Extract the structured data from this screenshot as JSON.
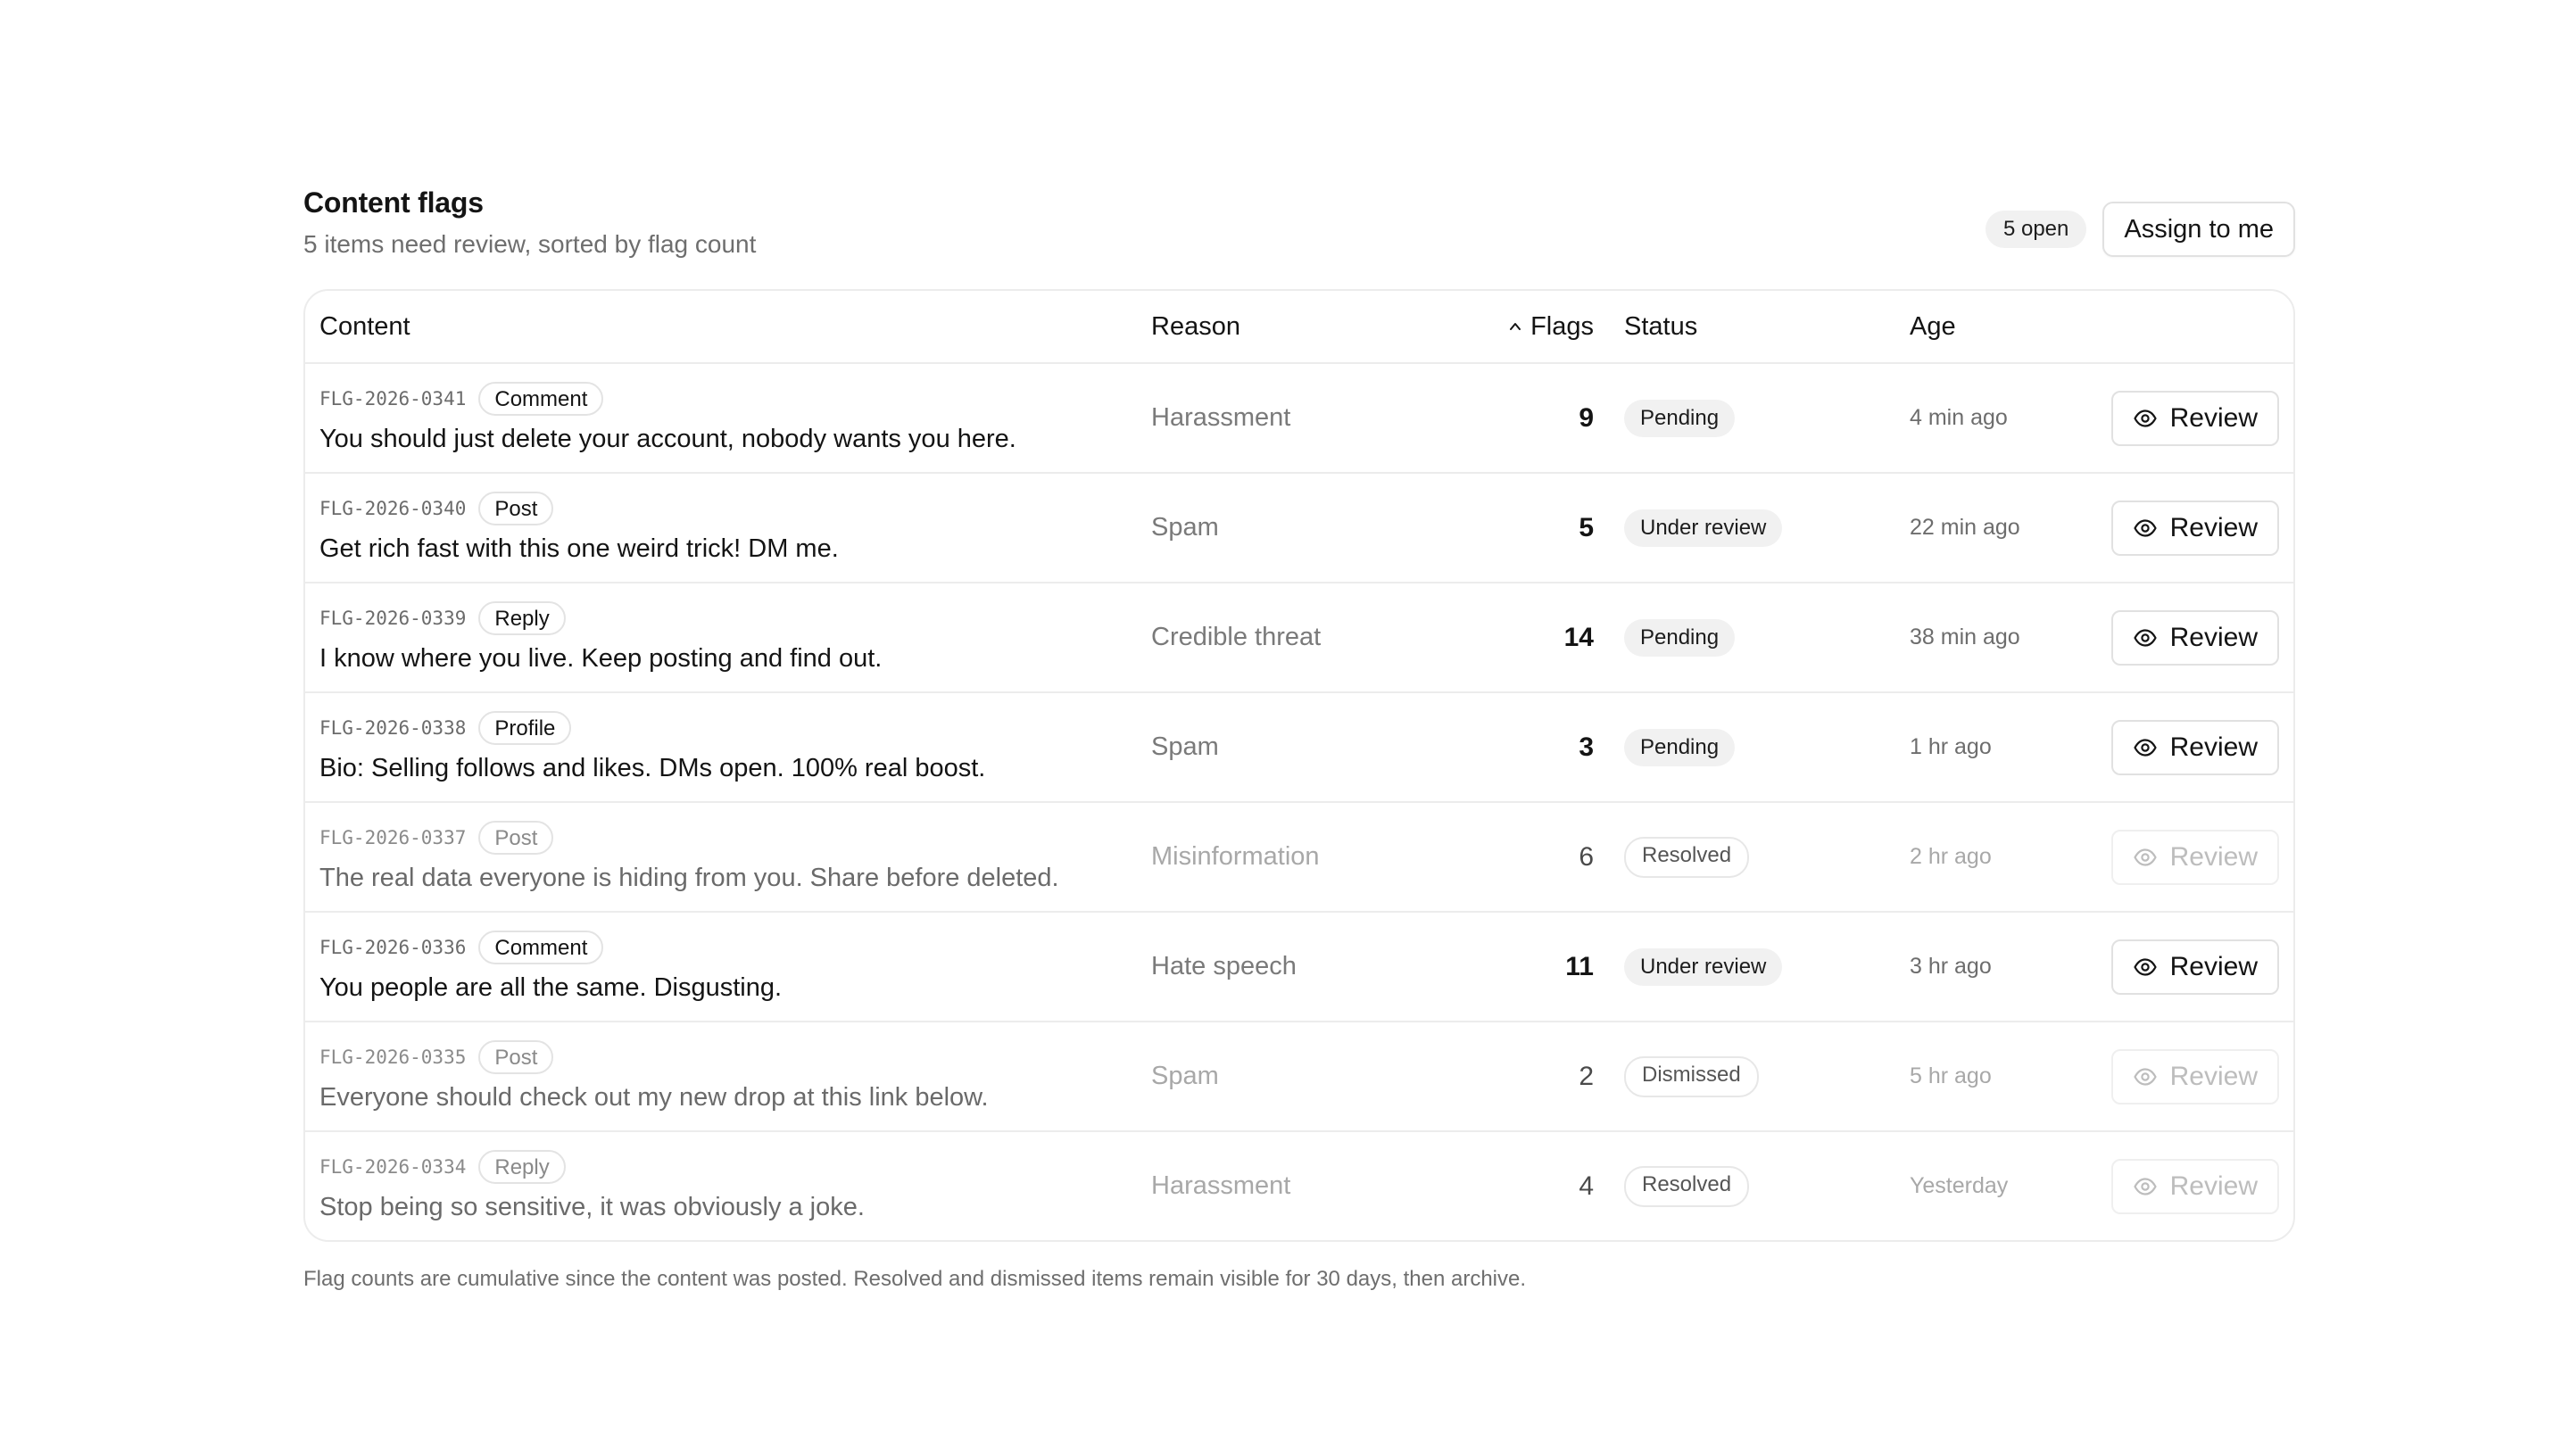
{
  "header": {
    "title": "Content flags",
    "subtitle": "5 items need review, sorted by flag count",
    "open_badge": "5 open",
    "assign_label": "Assign to me"
  },
  "table": {
    "columns": {
      "content": "Content",
      "reason": "Reason",
      "flags": "Flags",
      "status": "Status",
      "age": "Age"
    },
    "sort": {
      "column": "Flags",
      "direction": "ascending",
      "icon": "chevron-up-icon"
    },
    "review_label": "Review",
    "review_icon": "eye-icon",
    "rows": [
      {
        "id": "FLG-2026-0341",
        "type": "Comment",
        "text": "You should just delete your account, nobody wants you here.",
        "reason": "Harassment",
        "flags": "9",
        "status": "Pending",
        "status_kind": "pending",
        "age": "4 min ago",
        "muted": false
      },
      {
        "id": "FLG-2026-0340",
        "type": "Post",
        "text": "Get rich fast with this one weird trick! DM me.",
        "reason": "Spam",
        "flags": "5",
        "status": "Under review",
        "status_kind": "review",
        "age": "22 min ago",
        "muted": false
      },
      {
        "id": "FLG-2026-0339",
        "type": "Reply",
        "text": "I know where you live. Keep posting and find out.",
        "reason": "Credible threat",
        "flags": "14",
        "status": "Pending",
        "status_kind": "pending",
        "age": "38 min ago",
        "muted": false
      },
      {
        "id": "FLG-2026-0338",
        "type": "Profile",
        "text": "Bio: Selling follows and likes. DMs open. 100% real boost.",
        "reason": "Spam",
        "flags": "3",
        "status": "Pending",
        "status_kind": "pending",
        "age": "1 hr ago",
        "muted": false
      },
      {
        "id": "FLG-2026-0337",
        "type": "Post",
        "text": "The real data everyone is hiding from you. Share before deleted.",
        "reason": "Misinformation",
        "flags": "6",
        "status": "Resolved",
        "status_kind": "resolved",
        "age": "2 hr ago",
        "muted": true
      },
      {
        "id": "FLG-2026-0336",
        "type": "Comment",
        "text": "You people are all the same. Disgusting.",
        "reason": "Hate speech",
        "flags": "11",
        "status": "Under review",
        "status_kind": "review",
        "age": "3 hr ago",
        "muted": false
      },
      {
        "id": "FLG-2026-0335",
        "type": "Post",
        "text": "Everyone should check out my new drop at this link below.",
        "reason": "Spam",
        "flags": "2",
        "status": "Dismissed",
        "status_kind": "dismissed",
        "age": "5 hr ago",
        "muted": true
      },
      {
        "id": "FLG-2026-0334",
        "type": "Reply",
        "text": "Stop being so sensitive, it was obviously a joke.",
        "reason": "Harassment",
        "flags": "4",
        "status": "Resolved",
        "status_kind": "resolved",
        "age": "Yesterday",
        "muted": true
      }
    ]
  },
  "footnote": "Flag counts are cumulative since the content was posted. Resolved and dismissed items remain visible for 30 days, then archive."
}
